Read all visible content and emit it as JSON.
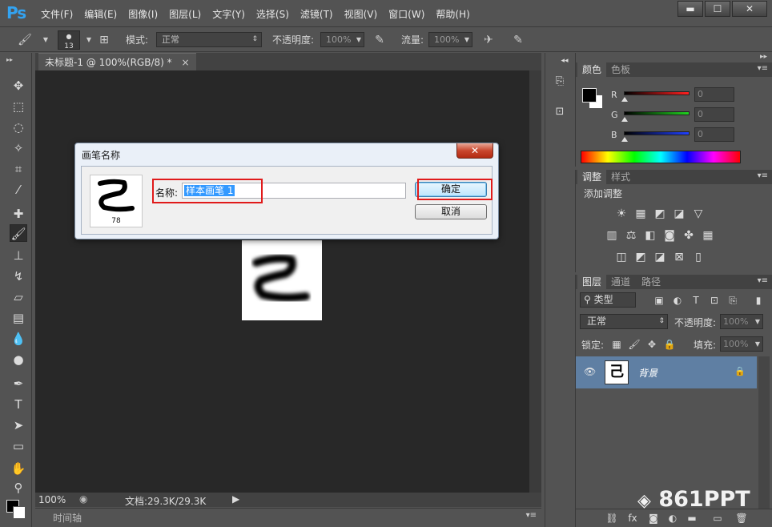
{
  "app": {
    "logo": "Ps"
  },
  "menu": [
    "文件(F)",
    "编辑(E)",
    "图像(I)",
    "图层(L)",
    "文字(Y)",
    "选择(S)",
    "滤镜(T)",
    "视图(V)",
    "窗口(W)",
    "帮助(H)"
  ],
  "window_buttons": {
    "minimize": "▬",
    "maximize": "☐",
    "close": "✕"
  },
  "options": {
    "brush_size": "13",
    "mode_label": "模式:",
    "mode_value": "正常",
    "opacity_label": "不透明度:",
    "opacity_value": "100%",
    "flow_label": "流量:",
    "flow_value": "100%"
  },
  "document": {
    "tab_title": "未标题-1 @ 100%(RGB/8) *",
    "tab_close": "×",
    "zoom": "100%",
    "doc_size": "文档:29.3K/29.3K",
    "timeline_label": "时间轴"
  },
  "dialog": {
    "title": "画笔名称",
    "close": "✕",
    "brush_number": "78",
    "name_label": "名称:",
    "name_value": "样本画笔 1",
    "ok_label": "确定",
    "cancel_label": "取消",
    "highlight_color": "#e01a1a"
  },
  "color_panel": {
    "tabs": [
      "颜色",
      "色板"
    ],
    "channels": [
      {
        "label": "R",
        "value": "0",
        "color": "#ff2020"
      },
      {
        "label": "G",
        "value": "0",
        "color": "#20d020"
      },
      {
        "label": "B",
        "value": "0",
        "color": "#2040ff"
      }
    ]
  },
  "adjust_panel": {
    "tabs": [
      "调整",
      "样式"
    ],
    "heading": "添加调整"
  },
  "layers_panel": {
    "tabs": [
      "图层",
      "通道",
      "路径"
    ],
    "filter_kind": "类型",
    "blend_mode": "正常",
    "opacity_label": "不透明度:",
    "opacity_value": "100%",
    "lock_label": "锁定:",
    "fill_label": "填充:",
    "fill_value": "100%",
    "layers": [
      {
        "name": "背景",
        "thumb_glyph": "己"
      }
    ]
  },
  "watermark": "861PPT"
}
